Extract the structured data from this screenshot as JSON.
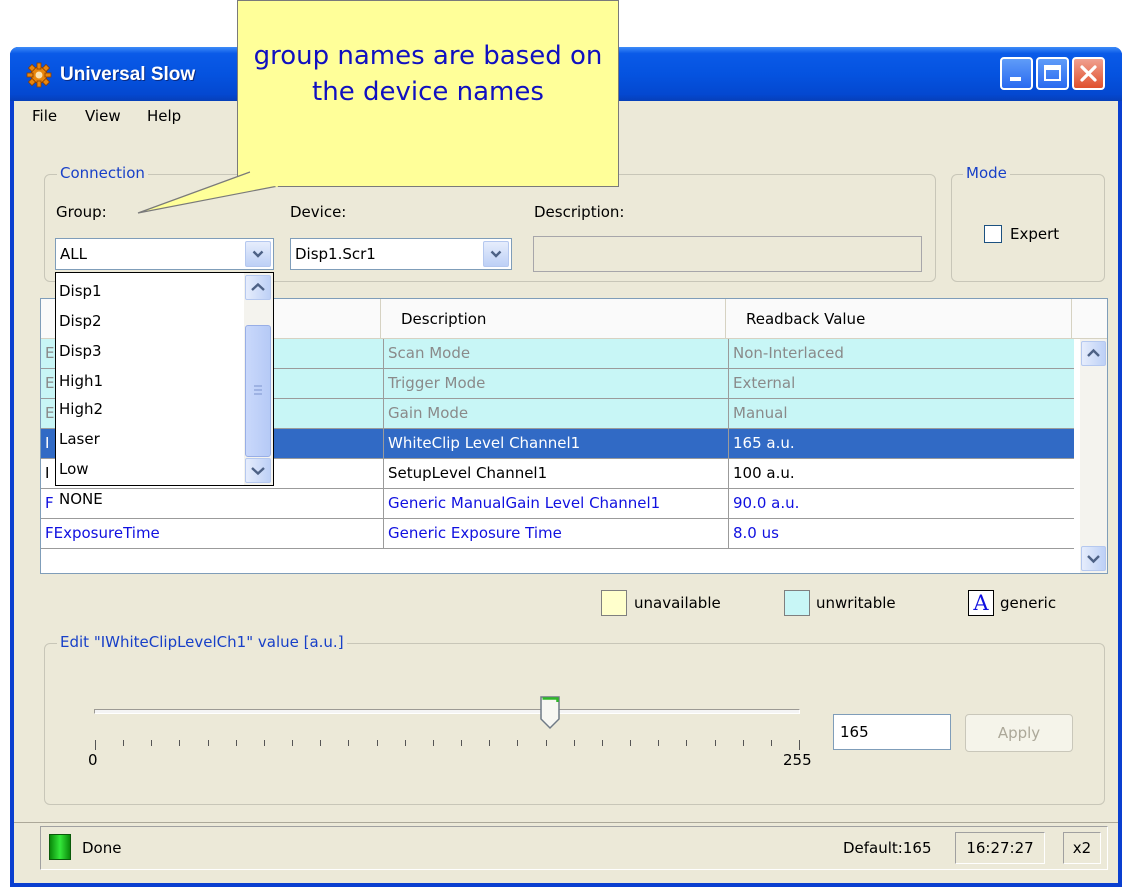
{
  "window": {
    "title": "Universal Slow",
    "colors": {
      "titlebar": "#0553e0",
      "client": "#ece9d8",
      "accent": "#316ac5",
      "groupTitle": "#1840c8"
    }
  },
  "menu": {
    "items": [
      "File",
      "View",
      "Help"
    ]
  },
  "connection": {
    "title": "Connection",
    "group_label": "Group:",
    "group_value": "ALL",
    "device_label": "Device:",
    "device_value": "Disp1.Scr1",
    "description_label": "Description:",
    "description_value": ""
  },
  "mode": {
    "title": "Mode",
    "expert_label": "Expert"
  },
  "dropdown": {
    "items": [
      "Disp1",
      "Disp2",
      "Disp3",
      "High1",
      "High2",
      "Laser",
      "Low",
      "NONE"
    ]
  },
  "table": {
    "headers": [
      "Description",
      "Readback Value"
    ],
    "rows": [
      {
        "name": "E",
        "description": "Scan Mode",
        "value": "Non-Interlaced"
      },
      {
        "name": "E",
        "description": "Trigger Mode",
        "value": "External"
      },
      {
        "name": "E",
        "description": "Gain Mode",
        "value": "Manual"
      },
      {
        "name": "I",
        "description": "WhiteClip Level Channel1",
        "value": "165 a.u."
      },
      {
        "name": "I",
        "description": "SetupLevel Channel1",
        "value": "100 a.u."
      },
      {
        "name": "F",
        "description": "Generic ManualGain Level Channel1",
        "value": "90.0 a.u."
      },
      {
        "name": "FExposureTime",
        "description": "Generic Exposure Time",
        "value": "8.0 us"
      }
    ]
  },
  "legend": {
    "unavailable": "unavailable",
    "unwritable": "unwritable",
    "generic_glyph": "A",
    "generic": "generic"
  },
  "edit": {
    "title": "Edit \"IWhiteClipLevelCh1\" value [a.u.]",
    "min": "0",
    "max": "255",
    "slider_fraction": 0.647,
    "value": "165",
    "apply_label": "Apply"
  },
  "status": {
    "text": "Done",
    "default": "Default:165",
    "time": "16:27:27",
    "zoom": "x2"
  },
  "callout": {
    "text": "group names are based on the device names"
  }
}
